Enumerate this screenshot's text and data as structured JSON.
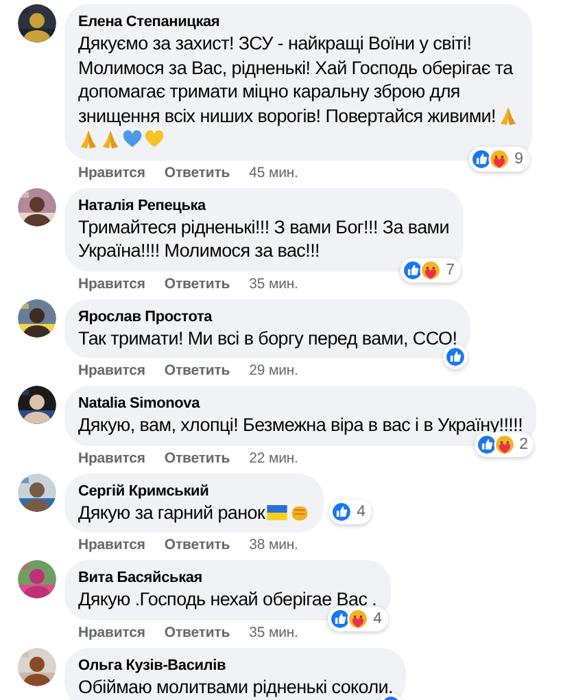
{
  "comments": [
    {
      "author": "Елена Степаницкая",
      "lines": [
        "Дякуємо за захист! ЗСУ - найкращі Воїни у світі!",
        "Молимося за Вас, рідненькі! Хай Господь оберігає та",
        "допомагає тримати міцно каральну зброю для",
        "знищення всіх ниших ворогів! Повертайся живими!"
      ],
      "emoji_rows": [
        [
          {
            "kind": "pray"
          }
        ],
        [
          {
            "kind": "pray"
          },
          {
            "kind": "pray"
          },
          {
            "kind": "blue-heart"
          },
          {
            "kind": "yellow-heart"
          }
        ]
      ],
      "reactions": {
        "beside": false,
        "icons": [
          {
            "kind": "like"
          },
          {
            "kind": "care"
          }
        ],
        "count": "9"
      },
      "like": "Нравится",
      "reply": "Ответить",
      "time": "45 мин."
    },
    {
      "author": "Наталія Репецька",
      "lines": [
        "Тримайтеся рідненькі!!! З вами Бог!!! За вами",
        "Україна!!!! Молимося за вас!!!"
      ],
      "reactions": {
        "beside": false,
        "icons": [
          {
            "kind": "like"
          },
          {
            "kind": "care"
          }
        ],
        "count": "7"
      },
      "like": "Нравится",
      "reply": "Ответить",
      "time": "35 мин."
    },
    {
      "author": "Ярослав Простота",
      "lines": [
        "Так тримати! Ми всі в боргу перед вами, ССО!"
      ],
      "reactions": {
        "beside": false,
        "icons": [
          {
            "kind": "like"
          }
        ]
      },
      "like": "Нравится",
      "reply": "Ответить",
      "time": "29 мин."
    },
    {
      "author": "Natalia Simonova",
      "lines": [
        "Дякую, вам, хлопці! Безмежна віра в вас і в Україну!!!!!"
      ],
      "reactions": {
        "beside": false,
        "icons": [
          {
            "kind": "like"
          },
          {
            "kind": "care"
          }
        ],
        "count": "2"
      },
      "like": "Нравится",
      "reply": "Ответить",
      "time": "22 мин."
    },
    {
      "author": "Сергій Кримський",
      "lines": [
        "Дякую за гарний ранок"
      ],
      "emoji_rows": [
        [
          {
            "kind": "flag"
          },
          {
            "kind": "fist"
          }
        ]
      ],
      "reactions": {
        "beside": true,
        "icons": [
          {
            "kind": "like"
          }
        ],
        "count": "4"
      },
      "like": "Нравится",
      "reply": "Ответить",
      "time": "38 мин."
    },
    {
      "author": "Вита Басяйськая",
      "lines": [
        "Дякую .Господь нехай оберігае Вас ."
      ],
      "reactions": {
        "beside": false,
        "icons": [
          {
            "kind": "like"
          },
          {
            "kind": "care"
          }
        ],
        "count": "4"
      },
      "like": "Нравится",
      "reply": "Ответить",
      "time": "35 мин."
    },
    {
      "author": "Ольга Кузів-Василів",
      "lines": [
        "Обіймаю молитвами рідненькі соколи."
      ],
      "reactions": {
        "beside": false,
        "icons": [
          {
            "kind": "like"
          }
        ]
      }
    }
  ]
}
